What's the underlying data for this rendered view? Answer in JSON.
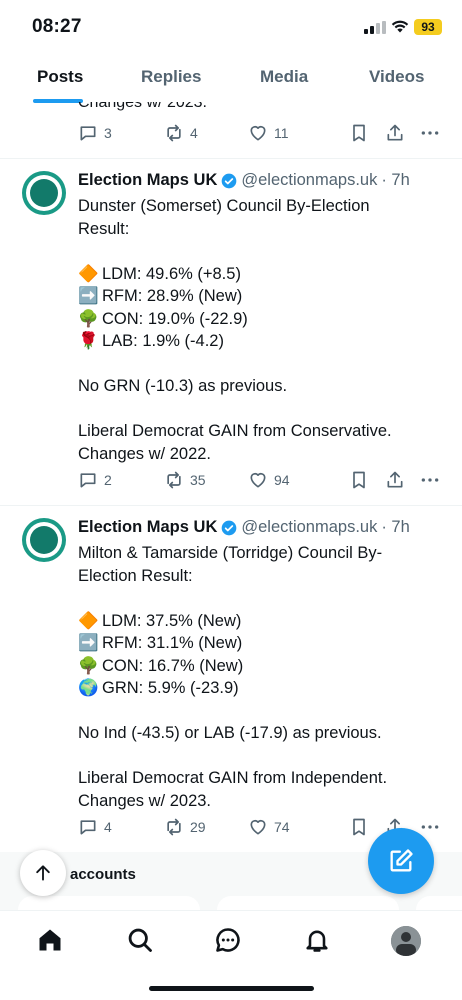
{
  "status_bar": {
    "time": "08:27",
    "battery": "93"
  },
  "tabs": [
    {
      "label": "Posts",
      "active": true
    },
    {
      "label": "Replies",
      "active": false
    },
    {
      "label": "Media",
      "active": false
    },
    {
      "label": "Videos",
      "active": false
    }
  ],
  "partial_tweet": {
    "text": "Changes w/ 2023.",
    "replies": "3",
    "reposts": "4",
    "likes": "11"
  },
  "tweets": [
    {
      "name": "Election Maps UK",
      "handle": "@electionmaps.uk",
      "time": "· 7h",
      "lines": [
        "Dunster (Somerset) Council By-Election",
        "Result:",
        "",
        "LDM: 49.6% (+8.5)",
        "RFM: 28.9% (New)",
        "CON: 19.0% (-22.9)",
        "LAB: 1.9% (-4.2)",
        "",
        "No GRN (-10.3) as previous.",
        "",
        "Liberal Democrat GAIN from Conservative.",
        "Changes w/ 2022."
      ],
      "replies": "2",
      "reposts": "35",
      "likes": "94"
    },
    {
      "name": "Election Maps UK",
      "handle": "@electionmaps.uk",
      "time": "· 7h",
      "lines": [
        "Milton & Tamarside (Torridge) Council By-",
        "Election Result:",
        "",
        "LDM: 37.5% (New)",
        "RFM: 31.1% (New)",
        "CON: 16.7% (New)",
        "GRN: 5.9% (-23.9)",
        "",
        "No Ind (-43.5) or LAB (-17.9) as previous.",
        "",
        "Liberal Democrat GAIN from Independent.",
        "Changes w/ 2023."
      ],
      "replies": "4",
      "reposts": "29",
      "likes": "74"
    }
  ],
  "follow_section": {
    "title": "accounts"
  },
  "colors": {
    "accent": "#1d9bf0",
    "muted": "#536471",
    "text": "#0f1419",
    "battery": "#f4cc1f"
  },
  "icons": {
    "ldm": "orange-diamond-emoji",
    "rfm": "right-arrow-emoji",
    "con": "tree-emoji",
    "lab": "rose-emoji",
    "grn": "globe-emoji"
  }
}
